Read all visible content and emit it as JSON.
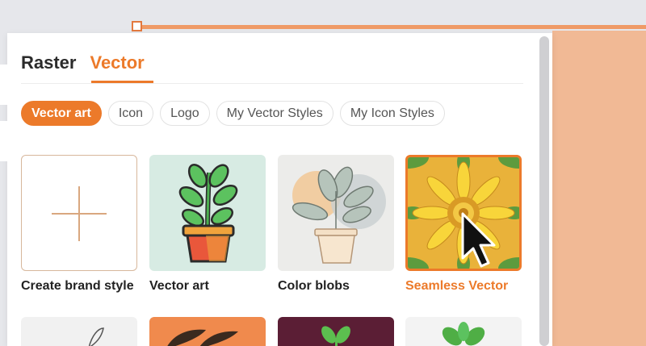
{
  "tabs": [
    {
      "label": "Raster",
      "active": false
    },
    {
      "label": "Vector",
      "active": true
    }
  ],
  "chips": [
    {
      "label": "Vector art",
      "active": true
    },
    {
      "label": "Icon",
      "active": false
    },
    {
      "label": "Logo",
      "active": false
    },
    {
      "label": "My Vector Styles",
      "active": false
    },
    {
      "label": "My Icon Styles",
      "active": false
    }
  ],
  "cards": [
    {
      "label": "Create brand style",
      "icon": "plus-icon"
    },
    {
      "label": "Vector art",
      "icon": "plant-icon"
    },
    {
      "label": "Color blobs",
      "icon": "plant-icon"
    },
    {
      "label": "Seamless Vector",
      "icon": "sunflower-icon",
      "selected": true
    }
  ],
  "colors": {
    "accent": "#ec7a2a",
    "canvas": "#f1b995",
    "background": "#e6e7eb"
  }
}
